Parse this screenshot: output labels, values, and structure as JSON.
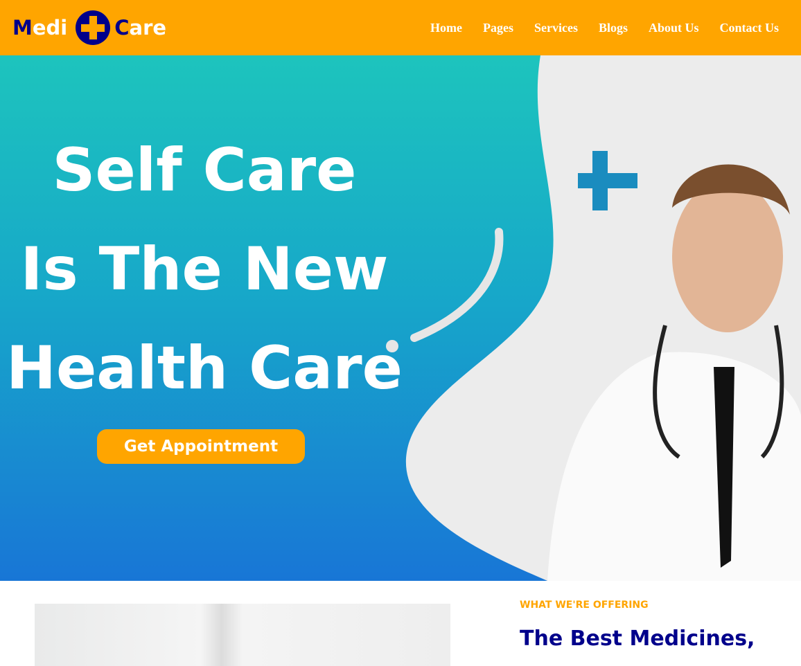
{
  "brand": {
    "part1_initial": "M",
    "part1_rest": "edi",
    "part2_initial": "C",
    "part2_rest": "are"
  },
  "nav": [
    "Home",
    "Pages",
    "Services",
    "Blogs",
    "About Us",
    "Contact Us"
  ],
  "hero": {
    "line1": "Self Care",
    "line2": "Is The New",
    "line3": "Health Care",
    "cta": "Get Appointment"
  },
  "offer": {
    "kicker": "WHAT WE'RE OFFERING",
    "title": "The Best Medicines,"
  },
  "colors": {
    "brand": "#FFA500",
    "navy": "#00008B"
  }
}
